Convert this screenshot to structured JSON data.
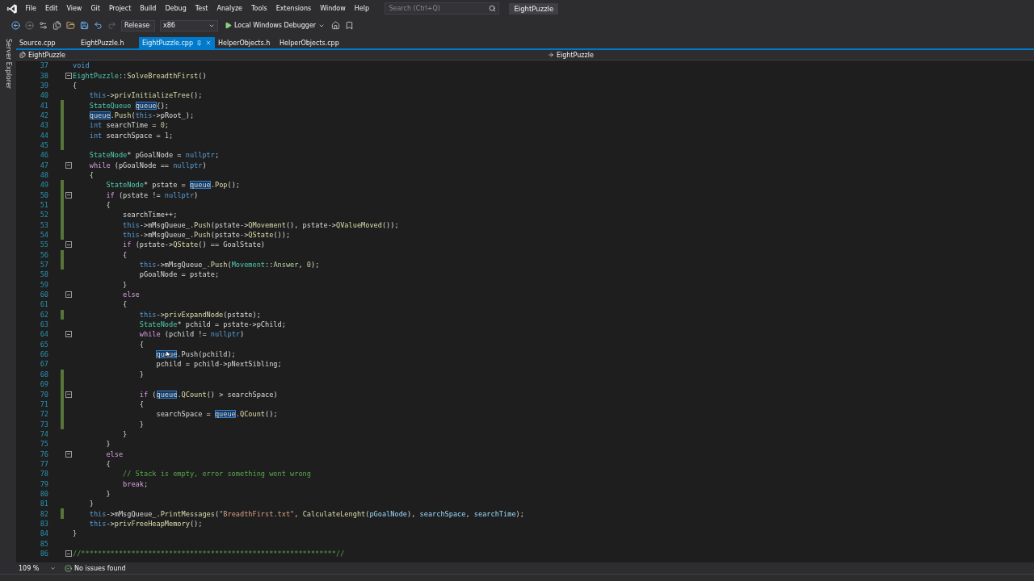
{
  "menu": [
    "File",
    "Edit",
    "View",
    "Git",
    "Project",
    "Build",
    "Debug",
    "Test",
    "Analyze",
    "Tools",
    "Extensions",
    "Window",
    "Help"
  ],
  "search": {
    "placeholder": "Search (Ctrl+Q)"
  },
  "solution_name": "EightPuzzle",
  "toolbar": {
    "configuration": "Release",
    "platform": "x86",
    "debugger": "Local Windows Debugger"
  },
  "side_panel": "Server Explorer",
  "tabs": [
    {
      "label": "Source.cpp",
      "selected": false
    },
    {
      "label": "EightPuzzle.h",
      "selected": false
    },
    {
      "label": "EightPuzzle.cpp",
      "selected": true
    },
    {
      "label": "HelperObjects.h",
      "selected": false
    },
    {
      "label": "HelperObjects.cpp",
      "selected": false
    }
  ],
  "nav": {
    "project": "EightPuzzle",
    "scope": "EightPuzzle"
  },
  "lines": [
    {
      "num": "37",
      "changed": false,
      "fold": false,
      "tokens": [
        {
          "kind": "keyword",
          "text": "void"
        }
      ]
    },
    {
      "num": "38",
      "changed": false,
      "fold": true,
      "tokens": [
        {
          "kind": "type",
          "text": "EightPuzzle"
        },
        {
          "kind": "plain",
          "text": "::"
        },
        {
          "kind": "function",
          "text": "SolveBreadthFirst"
        },
        {
          "kind": "plain",
          "text": "()"
        }
      ]
    },
    {
      "num": "39",
      "changed": false,
      "fold": false,
      "tokens": [
        {
          "kind": "plain",
          "text": "{"
        }
      ]
    },
    {
      "num": "40",
      "changed": false,
      "fold": false,
      "tokens": [
        {
          "kind": "keyword",
          "text": "    this"
        },
        {
          "kind": "plain",
          "text": "->"
        },
        {
          "kind": "function",
          "text": "privInitializeTree"
        },
        {
          "kind": "plain",
          "text": "();"
        }
      ]
    },
    {
      "num": "41",
      "changed": true,
      "fold": false,
      "tokens": [
        {
          "kind": "type",
          "text": "    StateQueue "
        },
        {
          "kind": "match",
          "text": "queue"
        },
        {
          "kind": "plain",
          "text": "{};"
        }
      ]
    },
    {
      "num": "42",
      "changed": true,
      "fold": false,
      "tokens": [
        {
          "kind": "match",
          "text": "    queue"
        },
        {
          "kind": "plain",
          "text": "."
        },
        {
          "kind": "function",
          "text": "Push"
        },
        {
          "kind": "plain",
          "text": "("
        },
        {
          "kind": "keyword",
          "text": "this"
        },
        {
          "kind": "plain",
          "text": "->pRoot_);"
        }
      ]
    },
    {
      "num": "43",
      "changed": true,
      "fold": false,
      "tokens": [
        {
          "kind": "keyword",
          "text": "    int"
        },
        {
          "kind": "plain",
          "text": " searchTime = "
        },
        {
          "kind": "number",
          "text": "0"
        },
        {
          "kind": "plain",
          "text": ";"
        }
      ]
    },
    {
      "num": "44",
      "changed": true,
      "fold": false,
      "tokens": [
        {
          "kind": "keyword",
          "text": "    int"
        },
        {
          "kind": "plain",
          "text": " searchSpace = "
        },
        {
          "kind": "number",
          "text": "1"
        },
        {
          "kind": "plain",
          "text": ";"
        }
      ]
    },
    {
      "num": "45",
      "changed": true,
      "fold": false
    },
    {
      "num": "46",
      "changed": false,
      "fold": false,
      "tokens": [
        {
          "kind": "type",
          "text": "    StateNode"
        },
        {
          "kind": "plain",
          "text": "* pGoalNode = "
        },
        {
          "kind": "keyword",
          "text": "nullptr"
        },
        {
          "kind": "plain",
          "text": ";"
        }
      ]
    },
    {
      "num": "47",
      "changed": false,
      "fold": true,
      "tokens": [
        {
          "kind": "control",
          "text": "    while"
        },
        {
          "kind": "plain",
          "text": " (pGoalNode == "
        },
        {
          "kind": "keyword",
          "text": "nullptr"
        },
        {
          "kind": "plain",
          "text": ")"
        }
      ]
    },
    {
      "num": "48",
      "changed": false,
      "fold": false,
      "tokens": [
        {
          "kind": "plain",
          "text": "    {"
        }
      ]
    },
    {
      "num": "49",
      "changed": true,
      "fold": false,
      "tokens": [
        {
          "kind": "type",
          "text": "        StateNode"
        },
        {
          "kind": "plain",
          "text": "* pstate = "
        },
        {
          "kind": "match",
          "text": "queue"
        },
        {
          "kind": "plain",
          "text": "."
        },
        {
          "kind": "function",
          "text": "Pop"
        },
        {
          "kind": "plain",
          "text": "();"
        }
      ]
    },
    {
      "num": "50",
      "changed": true,
      "fold": true,
      "tokens": [
        {
          "kind": "control",
          "text": "        if"
        },
        {
          "kind": "plain",
          "text": " (pstate != "
        },
        {
          "kind": "keyword",
          "text": "nullptr"
        },
        {
          "kind": "plain",
          "text": ")"
        }
      ]
    },
    {
      "num": "51",
      "changed": true,
      "fold": false,
      "tokens": [
        {
          "kind": "plain",
          "text": "        {"
        }
      ]
    },
    {
      "num": "52",
      "changed": true,
      "fold": false,
      "tokens": [
        {
          "kind": "plain",
          "text": "            searchTime++;"
        }
      ]
    },
    {
      "num": "53",
      "changed": true,
      "fold": false,
      "tokens": [
        {
          "kind": "keyword",
          "text": "            this"
        },
        {
          "kind": "plain",
          "text": "->mMsgQueue_."
        },
        {
          "kind": "function",
          "text": "Push"
        },
        {
          "kind": "plain",
          "text": "(pstate->"
        },
        {
          "kind": "function",
          "text": "QMovement"
        },
        {
          "kind": "plain",
          "text": "(), pstate->"
        },
        {
          "kind": "function",
          "text": "QValueMoved"
        },
        {
          "kind": "plain",
          "text": "());"
        }
      ]
    },
    {
      "num": "54",
      "changed": true,
      "fold": false,
      "tokens": [
        {
          "kind": "keyword",
          "text": "            this"
        },
        {
          "kind": "plain",
          "text": "->mMsgQueue_."
        },
        {
          "kind": "function",
          "text": "Push"
        },
        {
          "kind": "plain",
          "text": "(pstate->"
        },
        {
          "kind": "function",
          "text": "QState"
        },
        {
          "kind": "plain",
          "text": "());"
        }
      ]
    },
    {
      "num": "55",
      "changed": false,
      "fold": true,
      "tokens": [
        {
          "kind": "control",
          "text": "            if"
        },
        {
          "kind": "plain",
          "text": " (pstate->"
        },
        {
          "kind": "function",
          "text": "QState"
        },
        {
          "kind": "plain",
          "text": "() == GoalState)"
        }
      ]
    },
    {
      "num": "56",
      "changed": true,
      "fold": false,
      "tokens": [
        {
          "kind": "plain",
          "text": "            {"
        }
      ]
    },
    {
      "num": "57",
      "changed": true,
      "fold": false,
      "tokens": [
        {
          "kind": "keyword",
          "text": "                this"
        },
        {
          "kind": "plain",
          "text": "->mMsgQueue_."
        },
        {
          "kind": "function",
          "text": "Push"
        },
        {
          "kind": "plain",
          "text": "("
        },
        {
          "kind": "type",
          "text": "Movement"
        },
        {
          "kind": "plain",
          "text": "::"
        },
        {
          "kind": "enum",
          "text": "Answer"
        },
        {
          "kind": "plain",
          "text": ", "
        },
        {
          "kind": "number",
          "text": "0"
        },
        {
          "kind": "plain",
          "text": ");"
        }
      ]
    },
    {
      "num": "58",
      "changed": false,
      "fold": false,
      "tokens": [
        {
          "kind": "plain",
          "text": "                pGoalNode = pstate;"
        }
      ]
    },
    {
      "num": "59",
      "changed": false,
      "fold": false,
      "tokens": [
        {
          "kind": "plain",
          "text": "            }"
        }
      ]
    },
    {
      "num": "60",
      "changed": false,
      "fold": true,
      "tokens": [
        {
          "kind": "control",
          "text": "            else"
        }
      ]
    },
    {
      "num": "61",
      "changed": false,
      "fold": false,
      "tokens": [
        {
          "kind": "plain",
          "text": "            {"
        }
      ]
    },
    {
      "num": "62",
      "changed": true,
      "fold": false,
      "tokens": [
        {
          "kind": "keyword",
          "text": "                this"
        },
        {
          "kind": "plain",
          "text": "->"
        },
        {
          "kind": "function",
          "text": "privExpandNode"
        },
        {
          "kind": "plain",
          "text": "(pstate);"
        }
      ]
    },
    {
      "num": "63",
      "changed": false,
      "fold": false,
      "tokens": [
        {
          "kind": "type",
          "text": "                StateNode"
        },
        {
          "kind": "plain",
          "text": "* pchild = pstate->pChild;"
        }
      ]
    },
    {
      "num": "64",
      "changed": false,
      "fold": true,
      "tokens": [
        {
          "kind": "control",
          "text": "                while"
        },
        {
          "kind": "plain",
          "text": " (pchild != "
        },
        {
          "kind": "keyword",
          "text": "nullptr"
        },
        {
          "kind": "plain",
          "text": ")"
        }
      ]
    },
    {
      "num": "65",
      "changed": false,
      "fold": false,
      "tokens": [
        {
          "kind": "plain",
          "text": "                {"
        }
      ]
    },
    {
      "num": "66",
      "changed": false,
      "fold": false,
      "tokens": [
        {
          "kind": "match",
          "text": "                    queue"
        },
        {
          "kind": "plain",
          "text": ".Push(pchild);"
        }
      ]
    },
    {
      "num": "67",
      "changed": false,
      "fold": false,
      "tokens": [
        {
          "kind": "plain",
          "text": "                    pchild = pchild->pNextSibling;"
        }
      ]
    },
    {
      "num": "68",
      "changed": true,
      "fold": false,
      "tokens": [
        {
          "kind": "plain",
          "text": "                }"
        }
      ]
    },
    {
      "num": "69",
      "changed": true,
      "fold": false
    },
    {
      "num": "70",
      "changed": true,
      "fold": true,
      "tokens": [
        {
          "kind": "control",
          "text": "                if"
        },
        {
          "kind": "plain",
          "text": " ("
        },
        {
          "kind": "match",
          "text": "queue"
        },
        {
          "kind": "plain",
          "text": "."
        },
        {
          "kind": "function",
          "text": "QCount"
        },
        {
          "kind": "plain",
          "text": "() > searchSpace)"
        }
      ]
    },
    {
      "num": "71",
      "changed": true,
      "fold": false,
      "tokens": [
        {
          "kind": "plain",
          "text": "                {"
        }
      ]
    },
    {
      "num": "72",
      "changed": true,
      "fold": false,
      "tokens": [
        {
          "kind": "plain",
          "text": "                    searchSpace = "
        },
        {
          "kind": "match",
          "text": "queue"
        },
        {
          "kind": "plain",
          "text": "."
        },
        {
          "kind": "function",
          "text": "QCount"
        },
        {
          "kind": "plain",
          "text": "();"
        }
      ]
    },
    {
      "num": "73",
      "changed": true,
      "fold": false,
      "tokens": [
        {
          "kind": "plain",
          "text": "                }"
        }
      ]
    },
    {
      "num": "74",
      "changed": false,
      "fold": false,
      "tokens": [
        {
          "kind": "plain",
          "text": "            }"
        }
      ]
    },
    {
      "num": "75",
      "changed": false,
      "fold": false,
      "tokens": [
        {
          "kind": "plain",
          "text": "        }"
        }
      ]
    },
    {
      "num": "76",
      "changed": false,
      "fold": true,
      "tokens": [
        {
          "kind": "control",
          "text": "        else"
        }
      ]
    },
    {
      "num": "77",
      "changed": false,
      "fold": false,
      "tokens": [
        {
          "kind": "plain",
          "text": "        {"
        }
      ]
    },
    {
      "num": "78",
      "changed": false,
      "fold": false,
      "tokens": [
        {
          "kind": "comment",
          "text": "            // Stack is empty, error something went wrong"
        }
      ]
    },
    {
      "num": "79",
      "changed": false,
      "fold": false,
      "tokens": [
        {
          "kind": "control",
          "text": "            break"
        },
        {
          "kind": "plain",
          "text": ";"
        }
      ]
    },
    {
      "num": "80",
      "changed": false,
      "fold": false,
      "tokens": [
        {
          "kind": "plain",
          "text": "        }"
        }
      ]
    },
    {
      "num": "81",
      "changed": false,
      "fold": false,
      "tokens": [
        {
          "kind": "plain",
          "text": "    }"
        }
      ]
    },
    {
      "num": "82",
      "changed": true,
      "fold": false,
      "tokens": [
        {
          "kind": "keyword",
          "text": "    this"
        },
        {
          "kind": "plain",
          "text": "->mMsgQueue_."
        },
        {
          "kind": "function",
          "text": "PrintMessages"
        },
        {
          "kind": "plain",
          "text": "("
        },
        {
          "kind": "string",
          "text": "\"BreadthFirst.txt\""
        },
        {
          "kind": "plain",
          "text": ", "
        },
        {
          "kind": "function",
          "text": "CalculateLenght"
        },
        {
          "kind": "plain",
          "text": "("
        },
        {
          "kind": "param",
          "text": "pGoalNode"
        },
        {
          "kind": "plain",
          "text": "), "
        },
        {
          "kind": "param",
          "text": "searchSpace"
        },
        {
          "kind": "plain",
          "text": ", "
        },
        {
          "kind": "param",
          "text": "searchTime"
        },
        {
          "kind": "plain",
          "text": ");"
        }
      ]
    },
    {
      "num": "83",
      "changed": false,
      "fold": false,
      "tokens": [
        {
          "kind": "keyword",
          "text": "    this"
        },
        {
          "kind": "plain",
          "text": "->"
        },
        {
          "kind": "function",
          "text": "privFreeHeapMemory"
        },
        {
          "kind": "plain",
          "text": "();"
        }
      ]
    },
    {
      "num": "84",
      "changed": false,
      "fold": false,
      "tokens": [
        {
          "kind": "plain",
          "text": "}"
        }
      ]
    },
    {
      "num": "85",
      "changed": false,
      "fold": false
    },
    {
      "num": "86",
      "changed": false,
      "fold": true,
      "tokens": [
        {
          "kind": "comment",
          "text": "//*************************************************************//"
        }
      ]
    }
  ],
  "status": {
    "zoom": "109 %",
    "issues": "No issues found"
  }
}
